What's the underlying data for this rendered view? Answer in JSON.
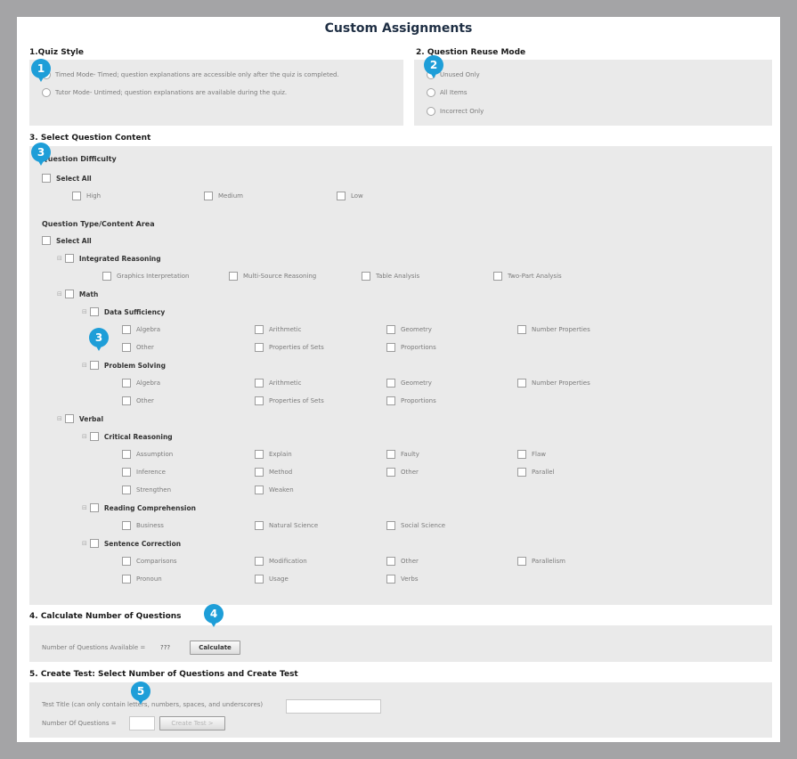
{
  "page": {
    "title": "Custom Assignments"
  },
  "quiz_style": {
    "heading": "1.Quiz Style",
    "options": [
      {
        "label": "Timed Mode- Timed; question explanations are accessible only after the quiz is completed."
      },
      {
        "label": "Tutor Mode- Untimed; question explanations are available during the quiz."
      }
    ]
  },
  "reuse_mode": {
    "heading": "2. Question Reuse Mode",
    "options": [
      {
        "label": "Unused Only"
      },
      {
        "label": "All Items"
      },
      {
        "label": "Incorrect Only"
      }
    ]
  },
  "content": {
    "heading": "3. Select Question Content",
    "difficulty": {
      "heading": "Question Difficulty",
      "select_all": "Select All",
      "levels": [
        "High",
        "Medium",
        "Low"
      ]
    },
    "type": {
      "heading": "Question Type/Content Area",
      "select_all": "Select All",
      "integrated_reasoning": {
        "label": "Integrated Reasoning",
        "items": [
          "Graphics Interpretation",
          "Multi-Source Reasoning",
          "Table Analysis",
          "Two-Part Analysis"
        ]
      },
      "math": {
        "label": "Math",
        "data_sufficiency": {
          "label": "Data Sufficiency",
          "items": [
            "Algebra",
            "Arithmetic",
            "Geometry",
            "Number Properties",
            "Other",
            "Properties of Sets",
            "Proportions"
          ]
        },
        "problem_solving": {
          "label": "Problem Solving",
          "items": [
            "Algebra",
            "Arithmetic",
            "Geometry",
            "Number Properties",
            "Other",
            "Properties of Sets",
            "Proportions"
          ]
        }
      },
      "verbal": {
        "label": "Verbal",
        "critical_reasoning": {
          "label": "Critical Reasoning",
          "items": [
            "Assumption",
            "Explain",
            "Faulty",
            "Flaw",
            "Inference",
            "Method",
            "Other",
            "Parallel",
            "Strengthen",
            "Weaken"
          ]
        },
        "reading_comprehension": {
          "label": "Reading Comprehension",
          "items": [
            "Business",
            "Natural Science",
            "Social Science"
          ]
        },
        "sentence_correction": {
          "label": "Sentence Correction",
          "items": [
            "Comparisons",
            "Modification",
            "Other",
            "Parallelism",
            "Pronoun",
            "Usage",
            "Verbs"
          ]
        }
      }
    }
  },
  "calculate": {
    "heading": "4. Calculate Number of Questions",
    "available_label": "Number of Questions Available =",
    "available_value": "???",
    "button": "Calculate"
  },
  "create": {
    "heading": "5. Create Test: Select Number of Questions and Create Test",
    "title_label": "Test Title (can only contain letters, numbers, spaces, and underscores)",
    "number_label": "Number Of Questions =",
    "button": "Create Test >"
  },
  "markers": [
    "1",
    "2",
    "3",
    "3",
    "4",
    "5"
  ],
  "colors": {
    "marker": "#1e9ed8",
    "panel": "#eaeaea",
    "frame": "#a4a4a6",
    "title": "#1f2f44"
  }
}
